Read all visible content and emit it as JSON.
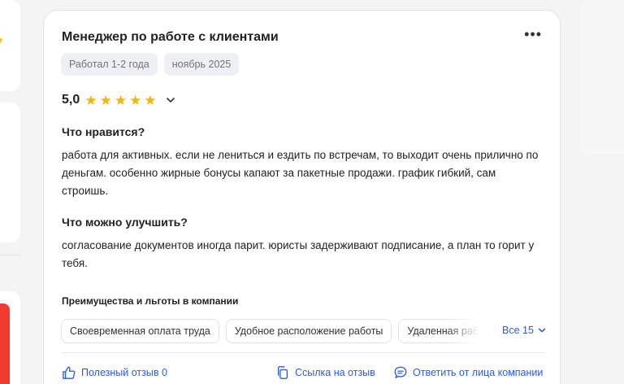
{
  "review": {
    "title": "Менеджер по работе с клиентами",
    "menu_icon": "more-dots-icon",
    "tenure_chip": "Работал 1-2 года",
    "date_chip": "ноябрь 2025",
    "rating": "5,0",
    "rating_stars": 5,
    "likes_heading": "Что нравится?",
    "likes_text": "работа для активных. если не лениться и ездить по встречам, то выходит очень прилично по деньгам. особенно жирные бонусы капают за пакетные продажи. график гибкий, сам строишь.",
    "improve_heading": "Что можно улучшить?",
    "improve_text": "согласование документов иногда парит. юристы задерживают подписание, а план то горит у тебя.",
    "perks_heading": "Преимущества и льготы в компании",
    "perks": [
      "Своевременная оплата труда",
      "Удобное расположение работы",
      "Удаленная работа"
    ],
    "perks_all_label": "Все 15",
    "actions": {
      "helpful": "Полезный отзыв 0",
      "link": "Ссылка на отзыв",
      "reply": "Ответить от лица компании"
    }
  },
  "colors": {
    "accent": "#2b5dd8",
    "star": "#f7b500",
    "chip_bg": "#eef0f3",
    "side_red": "#f23a2e"
  }
}
